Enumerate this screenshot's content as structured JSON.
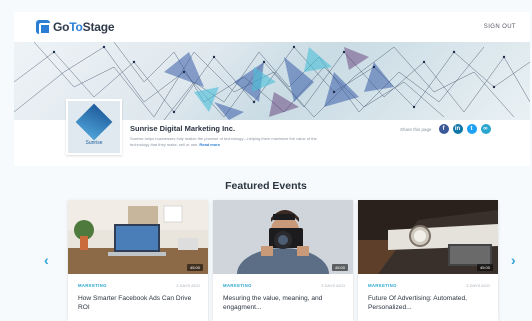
{
  "header": {
    "logo_text_a": "Go",
    "logo_text_b": "To",
    "logo_text_c": "Stage",
    "signout": "SIGN OUT"
  },
  "company": {
    "logo_text": "Sunrise",
    "name": "Sunrise Digital Marketing Inc.",
    "description": "Sunrise helps businesses fully realize the promise of technology—helping them maximize the value of the technology that they make, sell or use.",
    "read_more": "Read more",
    "share_label": "Share this page",
    "social_icons": [
      "facebook-icon",
      "linkedin-icon",
      "twitter-icon",
      "link-icon"
    ]
  },
  "featured": {
    "title": "Featured Events",
    "cards": [
      {
        "category": "MARKETING",
        "date": "3 DAYS AGO",
        "duration": "45:00",
        "title": "How Smarter Facebook Ads Can Drive ROI"
      },
      {
        "category": "MARKETING",
        "date": "3 DAYS AGO",
        "duration": "45:00",
        "title": "Mesuring the value, meaning, and engagment..."
      },
      {
        "category": "MARKETING",
        "date": "3 DAYS AGO",
        "duration": "45:00",
        "title": "Future Of Advertising: Automated, Personalized..."
      }
    ]
  },
  "colors": {
    "accent": "#2a7fd4",
    "category": "#2aa6cf",
    "arrow": "#2a9fd6"
  }
}
